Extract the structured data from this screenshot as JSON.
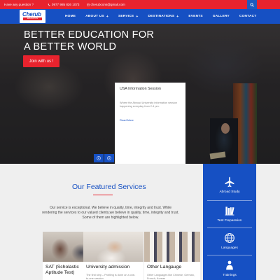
{
  "topbar": {
    "question": "Have any question ?",
    "phone": "0977 985 826 1073",
    "email": "cherubcons@gmail.com"
  },
  "logo": {
    "name": "Cherub",
    "tagline": "EDUCATION"
  },
  "nav": {
    "items": [
      {
        "label": "HOME"
      },
      {
        "label": "ABOUT US",
        "dropdown": true
      },
      {
        "label": "SERVICE",
        "dropdown": true
      },
      {
        "label": "DESTINATIONS",
        "dropdown": true
      },
      {
        "label": "EVENTS"
      },
      {
        "label": "GALLERY"
      },
      {
        "label": "CONTACT"
      }
    ],
    "dropdown_symbol": "+"
  },
  "hero": {
    "title_line1": "BETTER EDUCATION FOR",
    "title_line2": "A BETTER WORLD",
    "cta": "Join with us !"
  },
  "session": {
    "title": "USA Information Session",
    "body": "Where the Abroad University information session happening everyday from 2-4 pm.",
    "read_more": "Read More"
  },
  "featured": {
    "title": "Our Featured Services",
    "description": "Our service is exceptional. We believe in quality, time, integrity and trust. While rendering the services to our valued clients,we believe in quality, time, integrity and trust. Some of them are highlighted below.",
    "cards": [
      {
        "title": "SAT (Scholastic Aptitude Test)",
        "body": ""
      },
      {
        "title": "University admission",
        "body": "The first step – Profiling is done on a one-to-one session"
      },
      {
        "title": "Other Langauge",
        "body": "Other Languages like Chinese, German, French, Korean"
      }
    ]
  },
  "sidebar": {
    "items": [
      {
        "label": "Abroad Study",
        "icon": "airplane-icon"
      },
      {
        "label": "Test Preparation",
        "icon": "books-icon"
      },
      {
        "label": "Languages",
        "icon": "globe-icon"
      },
      {
        "label": "Trainings",
        "icon": "training-icon"
      }
    ]
  },
  "colors": {
    "brand_blue": "#1650c3",
    "accent_red": "#e8232e"
  }
}
